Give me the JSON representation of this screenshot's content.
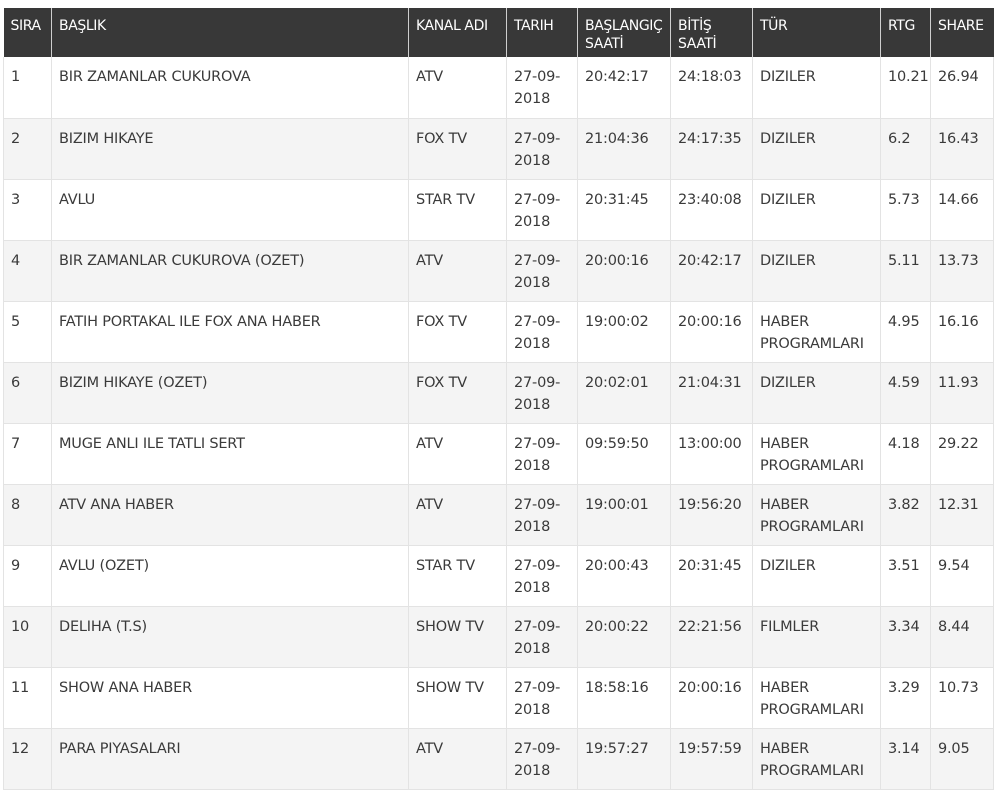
{
  "table": {
    "headers": [
      "SIRA",
      "BAŞLIK",
      "KANAL ADI",
      "TARIH",
      "BAŞLANGIÇ SAATİ",
      "BİTİŞ SAATİ",
      "TÜR",
      "RTG",
      "SHARE"
    ],
    "rows": [
      [
        "1",
        "BIR ZAMANLAR CUKUROVA",
        "ATV",
        "27-09-2018",
        "20:42:17",
        "24:18:03",
        "DIZILER",
        "10.21",
        "26.94"
      ],
      [
        "2",
        "BIZIM HIKAYE",
        "FOX TV",
        "27-09-2018",
        "21:04:36",
        "24:17:35",
        "DIZILER",
        "6.2",
        "16.43"
      ],
      [
        "3",
        "AVLU",
        "STAR TV",
        "27-09-2018",
        "20:31:45",
        "23:40:08",
        "DIZILER",
        "5.73",
        "14.66"
      ],
      [
        "4",
        "BIR ZAMANLAR CUKUROVA (OZET)",
        "ATV",
        "27-09-2018",
        "20:00:16",
        "20:42:17",
        "DIZILER",
        "5.11",
        "13.73"
      ],
      [
        "5",
        "FATIH PORTAKAL ILE FOX ANA HABER",
        "FOX TV",
        "27-09-2018",
        "19:00:02",
        "20:00:16",
        "HABER PROGRAMLARI",
        "4.95",
        "16.16"
      ],
      [
        "6",
        "BIZIM HIKAYE (OZET)",
        "FOX TV",
        "27-09-2018",
        "20:02:01",
        "21:04:31",
        "DIZILER",
        "4.59",
        "11.93"
      ],
      [
        "7",
        "MUGE ANLI ILE TATLI SERT",
        "ATV",
        "27-09-2018",
        "09:59:50",
        "13:00:00",
        "HABER PROGRAMLARI",
        "4.18",
        "29.22"
      ],
      [
        "8",
        "ATV ANA HABER",
        "ATV",
        "27-09-2018",
        "19:00:01",
        "19:56:20",
        "HABER PROGRAMLARI",
        "3.82",
        "12.31"
      ],
      [
        "9",
        "AVLU (OZET)",
        "STAR TV",
        "27-09-2018",
        "20:00:43",
        "20:31:45",
        "DIZILER",
        "3.51",
        "9.54"
      ],
      [
        "10",
        "DELIHA (T.S)",
        "SHOW TV",
        "27-09-2018",
        "20:00:22",
        "22:21:56",
        "FILMLER",
        "3.34",
        "8.44"
      ],
      [
        "11",
        "SHOW ANA HABER",
        "SHOW TV",
        "27-09-2018",
        "18:58:16",
        "20:00:16",
        "HABER PROGRAMLARI",
        "3.29",
        "10.73"
      ],
      [
        "12",
        "PARA PIYASALARI",
        "ATV",
        "27-09-2018",
        "19:57:27",
        "19:57:59",
        "HABER PROGRAMLARI",
        "3.14",
        "9.05"
      ]
    ]
  }
}
